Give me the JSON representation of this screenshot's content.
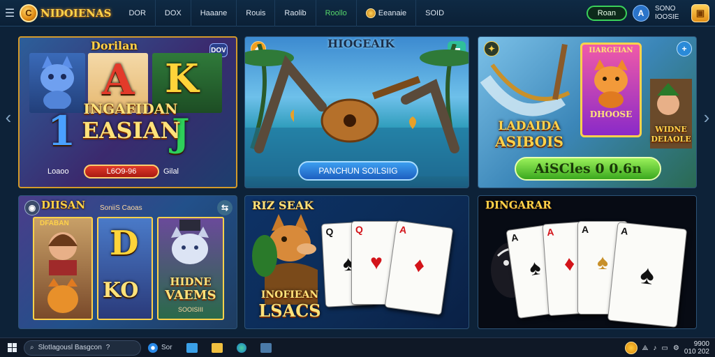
{
  "app": {
    "title": "NIDOIENAS",
    "logo_letter": "C"
  },
  "nav": {
    "menu_icon": "menu-icon",
    "items": [
      {
        "label": "DOR"
      },
      {
        "label": "DOX"
      },
      {
        "label": "Haaane"
      },
      {
        "label": "Rouis"
      },
      {
        "label": "Raolib"
      },
      {
        "label": "Roollo"
      },
      {
        "label": "Eeanaie"
      },
      {
        "label": "SOID"
      }
    ]
  },
  "header_right": {
    "login_label": "Roan",
    "avatar_letter": "A",
    "balance_line1": "SONO",
    "balance_line2": "IOOSIE",
    "wallet_icon": "wallet-icon"
  },
  "cards": [
    {
      "tag": "Dorilan",
      "corner_btn": "DOV",
      "letters": [
        "A",
        "K",
        "1",
        "J"
      ],
      "title_line1": "INGAFIDAN",
      "title_line2": "EASIAN",
      "label_left": "Loaoo",
      "pill": "L6O9-96",
      "label_right": "Gilal"
    },
    {
      "tag": "HIOGEAIK",
      "cta": "PANCHUN SOILSIIG"
    },
    {
      "label_line1": "LADAIDA",
      "label_line2": "ASIBOIS",
      "poster_title": "IIARGEIAN",
      "poster_sub": "DHOOSE",
      "right_line1": "WIDNE",
      "right_line2": "DEIAOLE",
      "cta": "AiSCles 0 0.6n"
    },
    {
      "tag": "DIISAN",
      "top_text": "SoniiS Caoas",
      "labels": [
        "DFABAN",
        "D",
        "KO",
        "HIDNE",
        "VAEMS",
        "SOOISIII"
      ]
    },
    {
      "tag": "RIZ SEAK",
      "title_line1": "INOFIEAN",
      "title_line2": "LSACS",
      "playing_cards": [
        {
          "rank": "Q",
          "suit": "♠",
          "color": "black"
        },
        {
          "rank": "Q",
          "suit": "♥",
          "color": "red"
        },
        {
          "rank": "A",
          "suit": "♦",
          "color": "red"
        }
      ]
    },
    {
      "tag": "DINGARAR",
      "playing_cards": [
        {
          "rank": "A",
          "suit": "♠",
          "color": "black"
        },
        {
          "rank": "A",
          "suit": "♦",
          "color": "red"
        },
        {
          "rank": "A",
          "suit": "♠",
          "color": "black"
        },
        {
          "rank": "A",
          "suit": "♠",
          "color": "black"
        }
      ]
    }
  ],
  "taskbar": {
    "search_text": "SlotIagousl Basgcon",
    "search_extra": "?",
    "apps": [
      {
        "label": "Sor",
        "icon": "browser-icon"
      },
      {
        "label": "",
        "icon": "window-icon"
      },
      {
        "label": "",
        "icon": "folder-icon"
      },
      {
        "label": "",
        "icon": "edge-icon"
      },
      {
        "label": "",
        "icon": "app-icon"
      }
    ],
    "clock_time": "9900",
    "clock_date": "010 202"
  },
  "colors": {
    "accent_gold": "#ffd24a",
    "accent_green": "#3ad15a",
    "background": "#0d2238"
  }
}
